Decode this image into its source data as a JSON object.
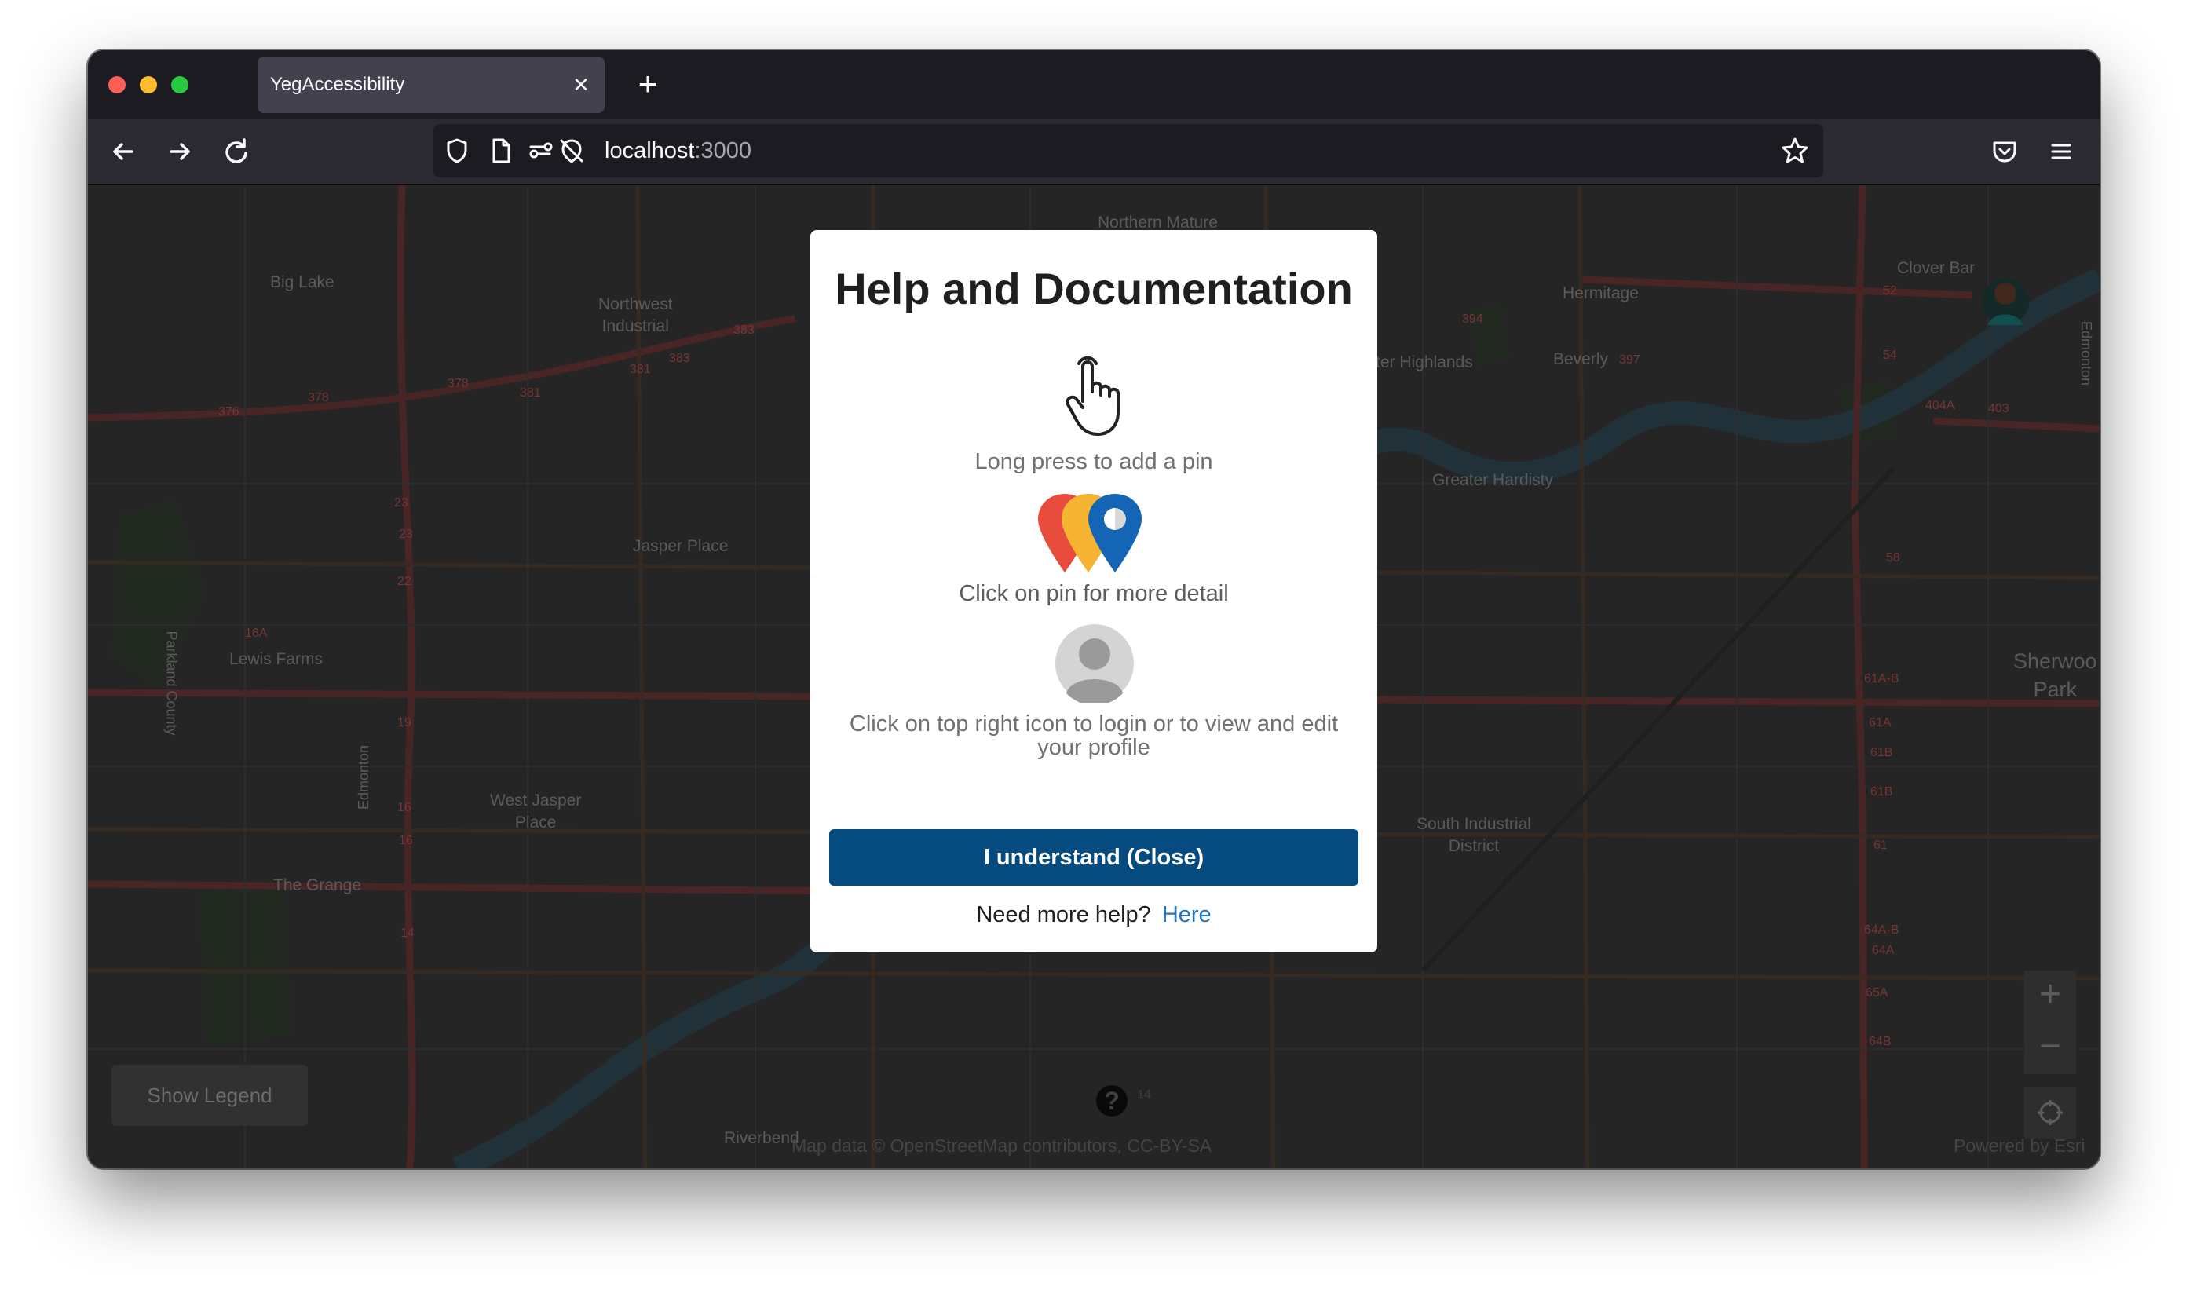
{
  "browser": {
    "tab_title": "YegAccessibility",
    "tab_close": "✕",
    "new_tab": "+",
    "url_host": "localhost",
    "url_port": ":3000"
  },
  "map": {
    "labels": {
      "northern_mature_area": "Northern Mature\nArea",
      "big_lake": "Big Lake",
      "northwest_industrial": "Northwest\nIndustrial",
      "hermitage": "Hermitage",
      "clover_bar": "Clover Bar",
      "castle_downs_highlands": "ter Highlands",
      "beverly": "Beverly",
      "greater_hardisty": "Greater Hardisty",
      "jasper_place": "Jasper Place",
      "lewis_farms": "Lewis Farms",
      "sherwood_park": "Sherwoo\nPark",
      "west_jasper_place": "West Jasper\nPlace",
      "south_industrial": "South Industrial\nDistrict",
      "the_grange": "The Grange",
      "riverbend": "Riverbend",
      "parkland_county": "Parkland County",
      "edmonton_east": "Edmonton",
      "edmonton_west": "Edmonton"
    },
    "road_numbers": [
      "376",
      "378",
      "378",
      "381",
      "381",
      "383",
      "383",
      "394",
      "397",
      "16A",
      "23",
      "23",
      "22",
      "19",
      "16",
      "16",
      "14",
      "403",
      "404A",
      "54",
      "52",
      "58",
      "61A-B",
      "61A",
      "61B",
      "61B",
      "61",
      "64A-B",
      "64A",
      "65A",
      "64B",
      "14"
    ],
    "show_legend": "Show Legend",
    "zoom_in": "+",
    "zoom_out": "−",
    "help_fab": "?",
    "attribution_left": "Map data © OpenStreetMap contributors, CC-BY-SA",
    "attribution_right": "Powered by Esri"
  },
  "modal": {
    "title": "Help and Documentation",
    "caption_long_press": "Long press to add a pin",
    "caption_click_pin": "Click on pin for more detail",
    "caption_profile": "Click on top right icon to login or to view and edit your profile",
    "understand_button": "I understand (Close)",
    "need_more_help": "Need more help?",
    "here_link": "Here",
    "icons": [
      "pointer-hand-icon",
      "map-pins-icon",
      "user-avatar-icon"
    ],
    "colors": {
      "button": "#064b80",
      "link": "#1e72c7",
      "pin_red": "#e84c3d",
      "pin_yellow": "#f5b532",
      "pin_blue": "#1565b7"
    }
  }
}
